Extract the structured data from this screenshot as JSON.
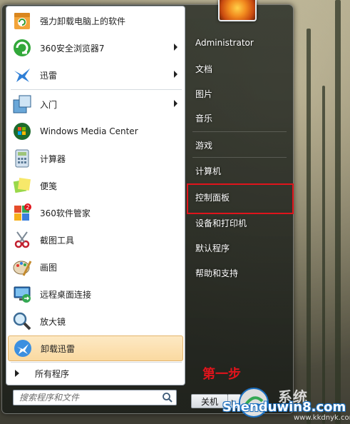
{
  "programs": [
    {
      "label": "强力卸载电脑上的软件",
      "icon": "uninstaller-box-icon",
      "submenu": false
    },
    {
      "label": "360安全浏览器7",
      "icon": "360-browser-icon",
      "submenu": true
    },
    {
      "label": "迅雷",
      "icon": "thunder-bird-icon",
      "submenu": true
    },
    {
      "label": "入门",
      "icon": "getting-started-icon",
      "submenu": true
    },
    {
      "label": "Windows Media Center",
      "icon": "windows-media-center-icon",
      "submenu": false
    },
    {
      "label": "计算器",
      "icon": "calculator-icon",
      "submenu": false
    },
    {
      "label": "便笺",
      "icon": "sticky-notes-icon",
      "submenu": false
    },
    {
      "label": "360软件管家",
      "icon": "360-software-manager-icon",
      "submenu": false,
      "badge": "2"
    },
    {
      "label": "截图工具",
      "icon": "snipping-tool-icon",
      "submenu": false
    },
    {
      "label": "画图",
      "icon": "paint-icon",
      "submenu": false
    },
    {
      "label": "远程桌面连接",
      "icon": "remote-desktop-icon",
      "submenu": false
    },
    {
      "label": "放大镜",
      "icon": "magnifier-icon",
      "submenu": false
    },
    {
      "label": "卸载迅雷",
      "icon": "uninstall-thunder-icon",
      "submenu": false
    }
  ],
  "all_programs": "所有程序",
  "search": {
    "placeholder": "搜索程序和文件"
  },
  "right": {
    "user": "Administrator",
    "items": [
      "文档",
      "图片",
      "音乐",
      "游戏",
      "计算机",
      "控制面板",
      "设备和打印机",
      "默认程序",
      "帮助和支持"
    ],
    "highlighted": "控制面板"
  },
  "shutdown": {
    "label": "关机"
  },
  "annotation": "第一步",
  "watermark": {
    "cn": "系统",
    "main": "Shenduwin8.com",
    "url": "www.kkdnyk.com"
  },
  "colors": {
    "annotation_red": "#e0141c",
    "highlight": "#fad9a0",
    "watermark_blue": "#1a6fc0"
  }
}
